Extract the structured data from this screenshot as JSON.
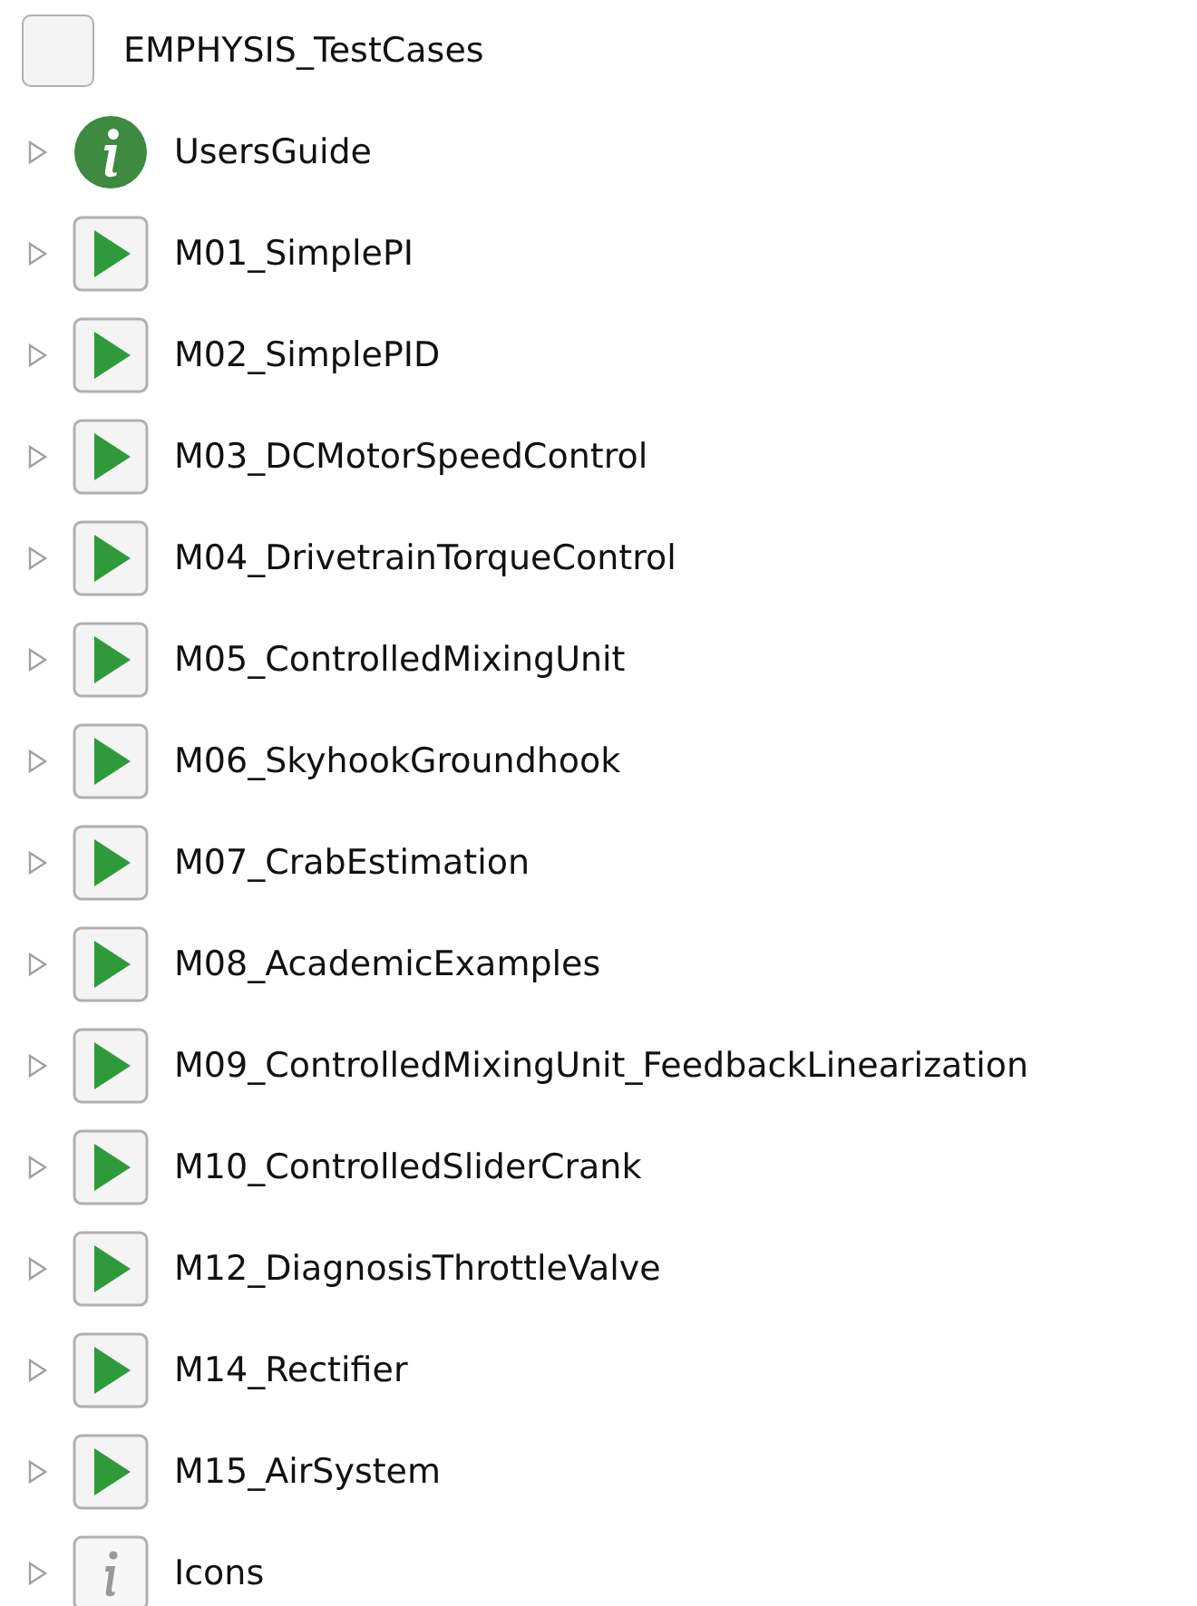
{
  "tree": {
    "label": "EMPHYSIS_TestCases",
    "kind": "package",
    "children": [
      {
        "label": "UsersGuide",
        "kind": "info",
        "expanded": false
      },
      {
        "label": "M01_SimplePI",
        "kind": "example",
        "expanded": false
      },
      {
        "label": "M02_SimplePID",
        "kind": "example",
        "expanded": false
      },
      {
        "label": "M03_DCMotorSpeedControl",
        "kind": "example",
        "expanded": false
      },
      {
        "label": "M04_DrivetrainTorqueControl",
        "kind": "example",
        "expanded": false
      },
      {
        "label": "M05_ControlledMixingUnit",
        "kind": "example",
        "expanded": false
      },
      {
        "label": "M06_SkyhookGroundhook",
        "kind": "example",
        "expanded": false
      },
      {
        "label": "M07_CrabEstimation",
        "kind": "example",
        "expanded": false
      },
      {
        "label": "M08_AcademicExamples",
        "kind": "example",
        "expanded": false
      },
      {
        "label": "M09_ControlledMixingUnit_FeedbackLinearization",
        "kind": "example",
        "expanded": false
      },
      {
        "label": "M10_ControlledSliderCrank",
        "kind": "example",
        "expanded": false
      },
      {
        "label": "M12_DiagnosisThrottleValve",
        "kind": "example",
        "expanded": false
      },
      {
        "label": "M14_Rectifier",
        "kind": "example",
        "expanded": false
      },
      {
        "label": "M15_AirSystem",
        "kind": "example",
        "expanded": false
      },
      {
        "label": "Icons",
        "kind": "icons",
        "expanded": false
      }
    ]
  }
}
